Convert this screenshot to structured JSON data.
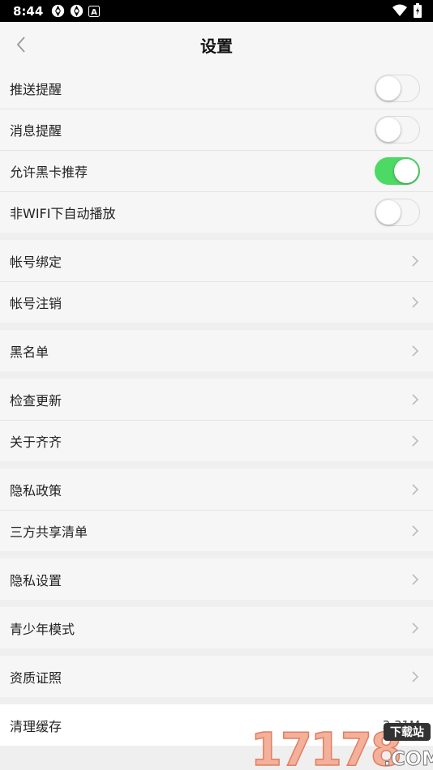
{
  "status_bar": {
    "time": "8:44",
    "notif_icon_letter": "A"
  },
  "header": {
    "title": "设置"
  },
  "toggles": [
    {
      "label": "推送提醒",
      "on": false
    },
    {
      "label": "消息提醒",
      "on": false
    },
    {
      "label": "允许黑卡推荐",
      "on": true
    },
    {
      "label": "非WIFI下自动播放",
      "on": false
    }
  ],
  "account": {
    "bind": "帐号绑定",
    "cancel": "帐号注销"
  },
  "blacklist": {
    "label": "黑名单"
  },
  "about": {
    "update": "检查更新",
    "about": "关于齐齐"
  },
  "privacy": {
    "policy": "隐私政策",
    "share_list": "三方共享清单"
  },
  "privacy_settings": {
    "label": "隐私设置"
  },
  "youth": {
    "label": "青少年模式"
  },
  "license": {
    "label": "资质证照"
  },
  "cache": {
    "label": "清理缓存",
    "value": "3.31M"
  },
  "watermark": {
    "digits": "17178",
    "tag": "下载站",
    "domain": ".COM"
  },
  "colors": {
    "toggle_on": "#4cd964",
    "background": "#efefef",
    "row": "#f6f6f6",
    "chevron": "#bbbbbb"
  }
}
